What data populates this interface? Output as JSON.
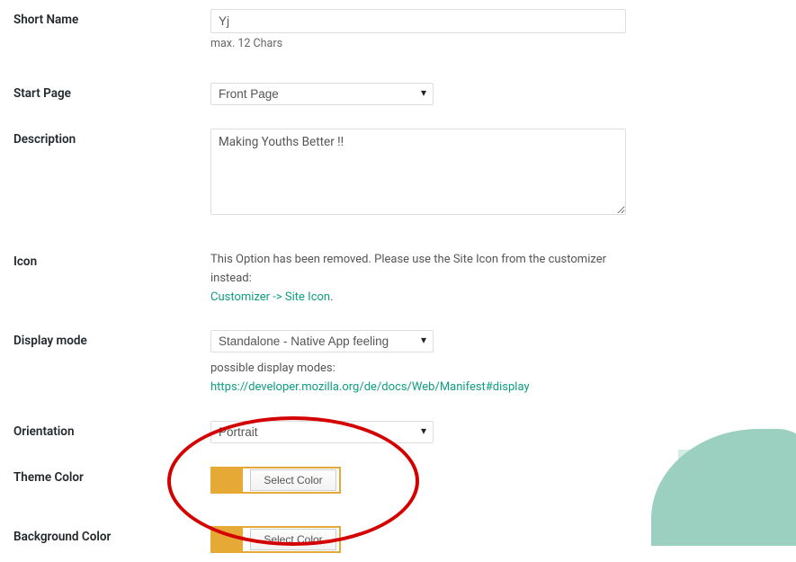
{
  "labels": {
    "short_name": "Short Name",
    "start_page": "Start Page",
    "description": "Description",
    "icon": "Icon",
    "display_mode": "Display mode",
    "orientation": "Orientation",
    "theme_color": "Theme Color",
    "background_color": "Background Color"
  },
  "fields": {
    "short_name_value": "Yj",
    "short_name_hint": "max. 12 Chars",
    "start_page_value": "Front Page",
    "description_value": "Making Youths Better !!",
    "icon_text": "This Option has been removed. Please use the Site Icon from the customizer instead:",
    "icon_link": "Customizer -> Site Icon",
    "display_mode_value": "Standalone - Native App feeling",
    "display_mode_desc_prefix": "possible display modes: ",
    "display_mode_link": "https://developer.mozilla.org/de/docs/Web/Manifest#display",
    "orientation_value": "Portrait",
    "select_color_label": "Select Color",
    "theme_color_hex": "#e6a936",
    "background_color_hex": "#e6a936"
  }
}
